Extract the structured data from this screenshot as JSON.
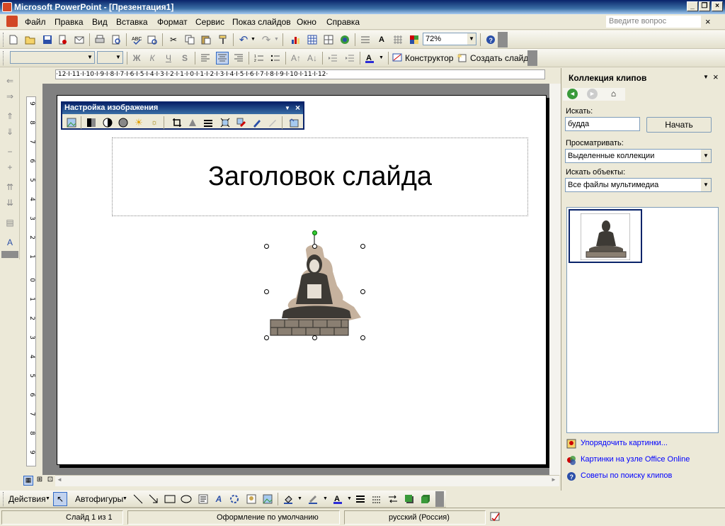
{
  "window": {
    "title": "Microsoft PowerPoint - [Презентация1]"
  },
  "menu": {
    "items": [
      "Файл",
      "Правка",
      "Вид",
      "Вставка",
      "Формат",
      "Сервис",
      "Показ слайдов",
      "Окно",
      "Справка"
    ],
    "ask_placeholder": "Введите вопрос",
    "close_x": "×"
  },
  "toolbar": {
    "zoom": "72%",
    "designer_label": "Конструктор",
    "new_slide_label": "Создать слайд",
    "font_bold": "Ж",
    "font_italic": "К",
    "font_underline": "Ч",
    "font_shadow": "S"
  },
  "ruler": {
    "h": "·12·I·11·I·10·I·9·I·8·I·7·I·6·I·5·I·4·I·3·I·2·I·1·I·0·I·1·I·2·I·3·I·4·I·5·I·6·I·7·I·8·I·9·I·10·I·11·I·12·",
    "v": [
      "9",
      "8",
      "7",
      "6",
      "5",
      "4",
      "3",
      "2",
      "1",
      "0",
      "1",
      "2",
      "3",
      "4",
      "5",
      "6",
      "7",
      "8",
      "9"
    ]
  },
  "picture_toolbar": {
    "title": "Настройка изображения"
  },
  "slide": {
    "title": "Заголовок слайда"
  },
  "taskpane": {
    "title": "Коллекция клипов",
    "search_label": "Искать:",
    "search_value": "будда",
    "go_button": "Начать",
    "browse_label": "Просматривать:",
    "browse_value": "Выделенные коллекции",
    "types_label": "Искать объекты:",
    "types_value": "Все файлы мультимедиа",
    "links": [
      "Упорядочить картинки...",
      "Картинки на узле Office Online",
      "Советы по поиску клипов"
    ]
  },
  "drawbar": {
    "actions": "Действия",
    "autoshapes": "Автофигуры"
  },
  "status": {
    "slide": "Слайд 1 из 1",
    "design": "Оформление по умолчанию",
    "language": "русский (Россия)"
  }
}
